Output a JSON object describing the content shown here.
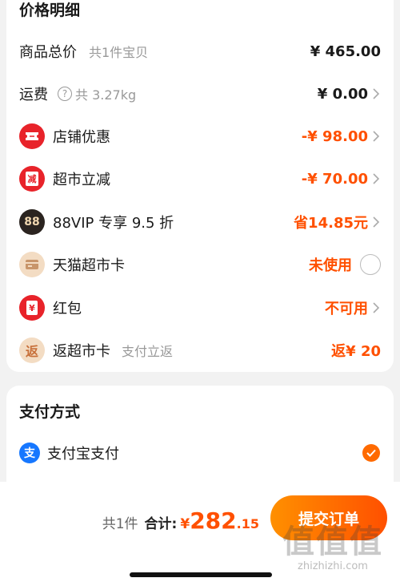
{
  "price_detail": {
    "title": "价格明细",
    "rows": [
      {
        "label": "商品总价",
        "sub": "共1件宝贝",
        "value": "¥ 465.00",
        "arrow": false
      },
      {
        "label": "运费",
        "sub": "共 3.27kg",
        "value": "¥ 0.00",
        "arrow": true
      },
      {
        "label": "店铺优惠",
        "value": "-¥ 98.00",
        "arrow": true
      },
      {
        "label": "超市立减",
        "icon_text": "减",
        "value": "-¥ 70.00",
        "arrow": true
      },
      {
        "label": "88VIP 专享 9.5 折",
        "icon_text": "88",
        "value": "省14.85元",
        "arrow": true
      },
      {
        "label": "天猫超市卡",
        "value": "未使用",
        "arrow": false
      },
      {
        "label": "红包",
        "icon_text": "¥",
        "value": "不可用",
        "arrow": true
      },
      {
        "label": "返超市卡",
        "icon_text": "返",
        "sub": "支付立返",
        "value": "返¥ 20",
        "arrow": false
      }
    ]
  },
  "payment": {
    "title": "支付方式",
    "method": "支付宝支付",
    "icon_text": "支"
  },
  "footer": {
    "count": "共1件",
    "total_label": "合计:",
    "currency": "¥",
    "total_int": "282",
    "total_dec": ".15",
    "submit_label": "提交订单"
  },
  "watermark": {
    "logo": "值值值",
    "url": "zhizhizhi.com"
  },
  "colors": {
    "accent": "#ff5000",
    "icon_red": "#e8232a",
    "vip_dark": "#2b2420",
    "beige": "#f3dcc3",
    "alipay_blue": "#1677ff"
  }
}
